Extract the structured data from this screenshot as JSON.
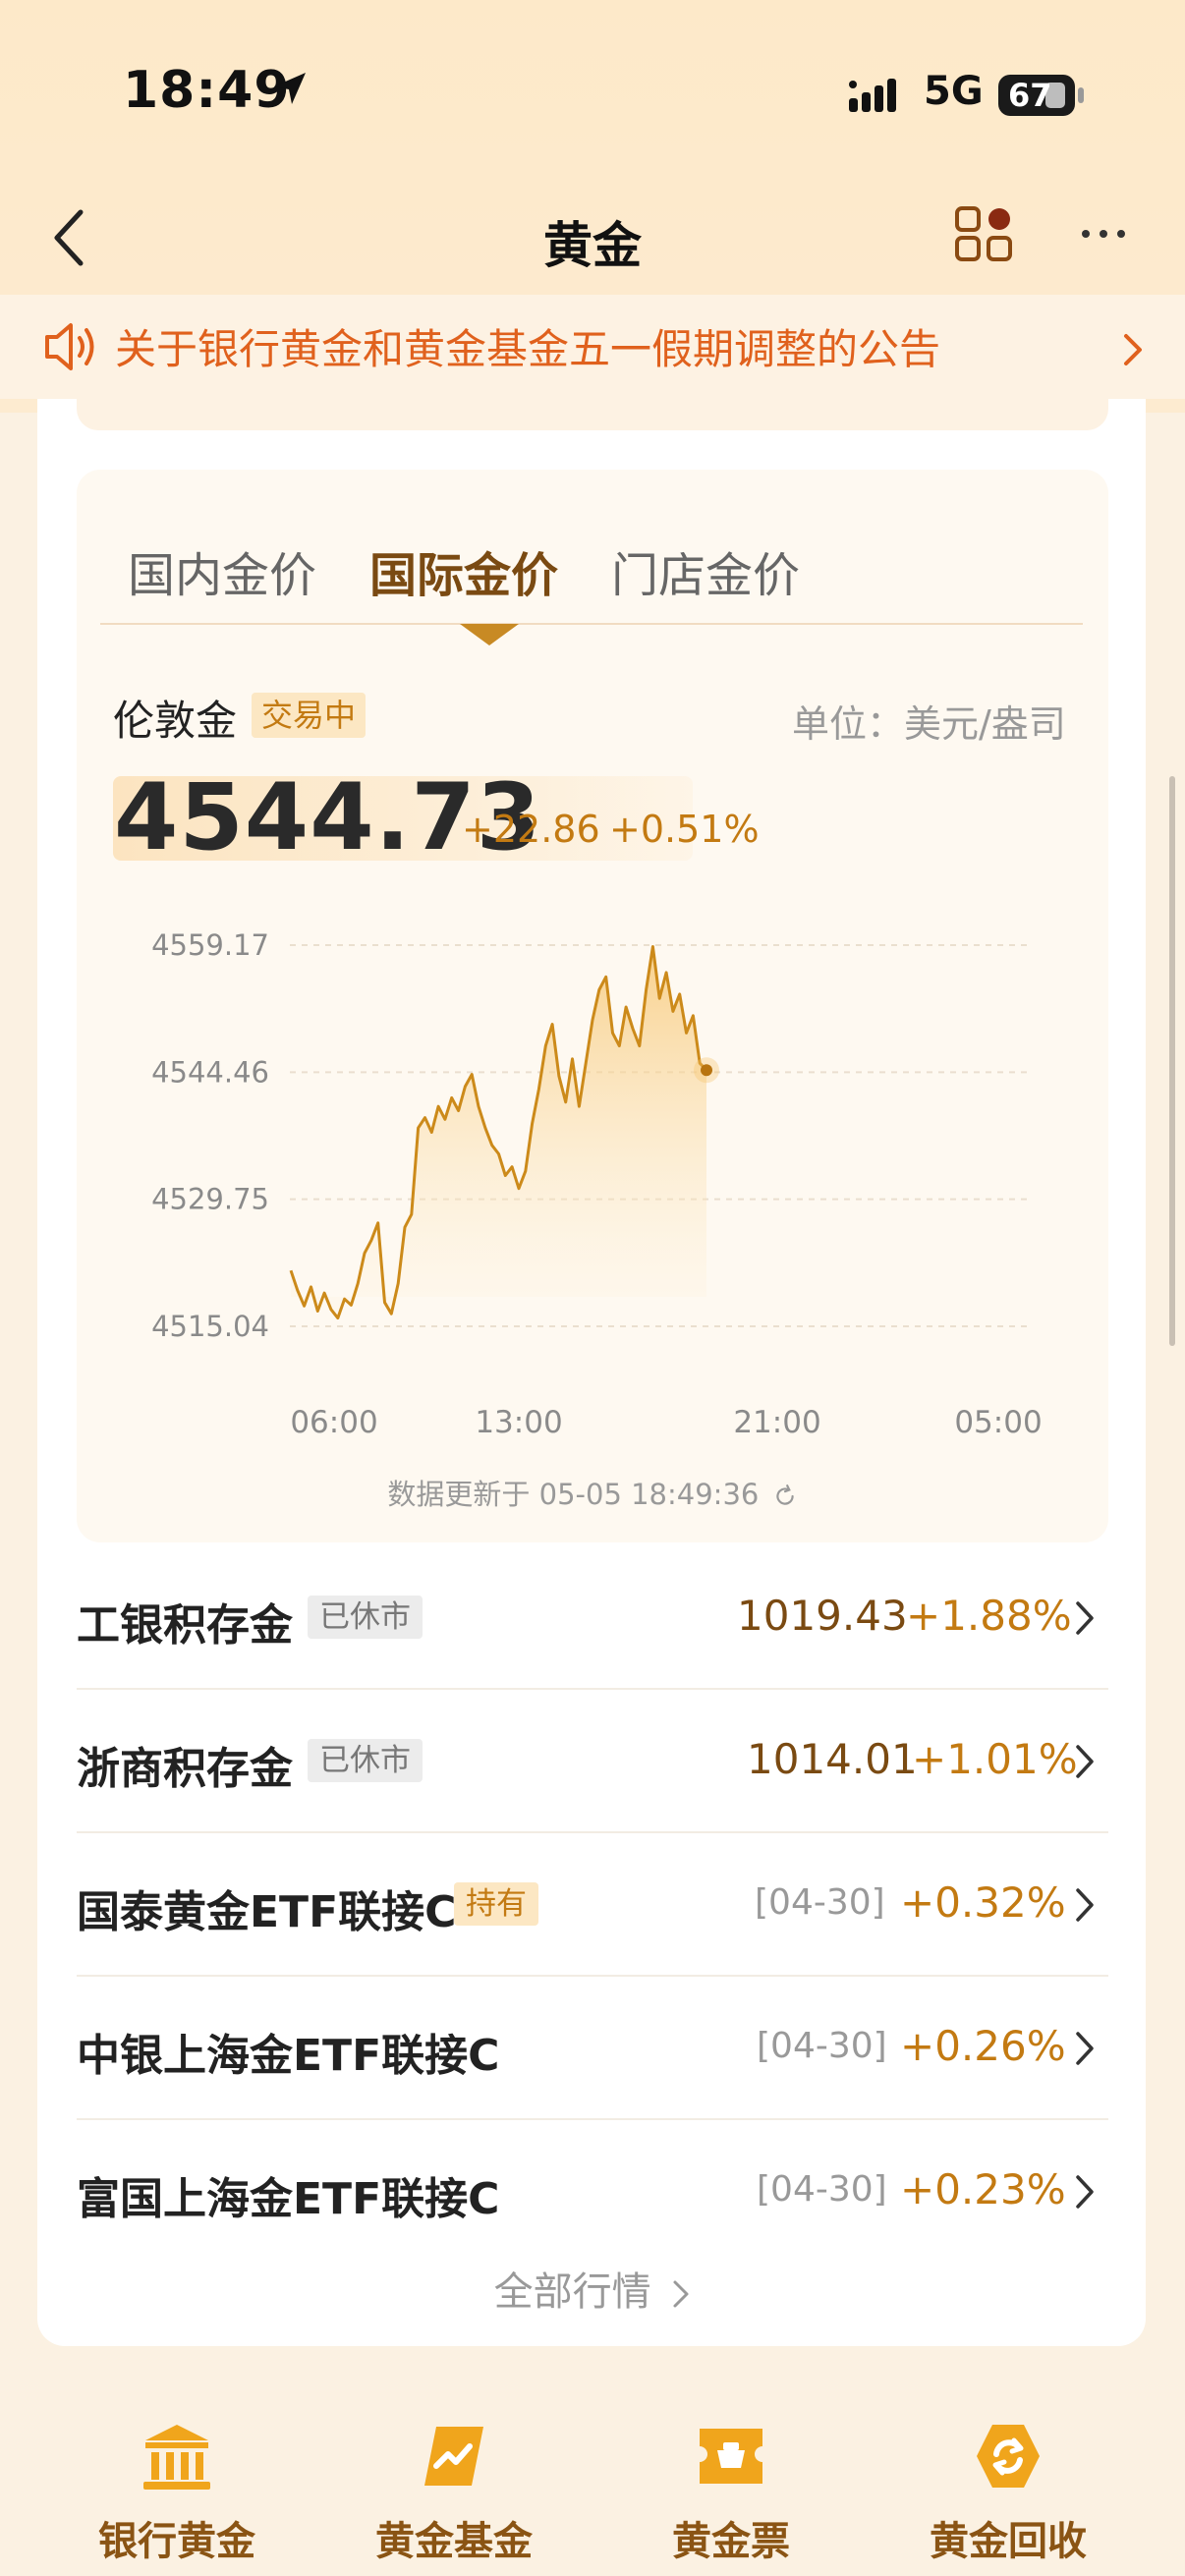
{
  "status_bar": {
    "time": "18:49",
    "network": "5G",
    "battery": "67"
  },
  "nav": {
    "title": "黄金"
  },
  "notice": {
    "text": "关于银行黄金和黄金基金五一假期调整的公告"
  },
  "tabs": [
    {
      "label": "国内金价",
      "active": false
    },
    {
      "label": "国际金价",
      "active": true
    },
    {
      "label": "门店金价",
      "active": false
    }
  ],
  "quote": {
    "market_name": "伦敦金",
    "status": "交易中",
    "unit": "单位：美元/盎司",
    "price": "4544.73",
    "change_abs": "+22.86",
    "change_pct": "+0.51%",
    "updated": "数据更新于 05-05 18:49:36"
  },
  "chart_data": {
    "type": "area",
    "y_ticks": [
      "4559.17",
      "4544.46",
      "4529.75",
      "4515.04"
    ],
    "ylim": [
      4515.04,
      4559.17
    ],
    "x_ticks": [
      "06:00",
      "13:00",
      "21:00",
      "05:00"
    ],
    "line_color": "#cc8a1a",
    "series": [
      {
        "values": [
          4521.5,
          4519.2,
          4517.4,
          4519.6,
          4516.8,
          4518.9,
          4517.0,
          4516.0,
          4518.2,
          4517.5,
          4520.0,
          4523.5,
          4525.0,
          4527.0,
          4517.8,
          4516.5,
          4520.0,
          4526.5,
          4528.0,
          4538.0,
          4539.2,
          4537.5,
          4540.5,
          4539.0,
          4541.5,
          4540.0,
          4542.8,
          4544.2,
          4540.5,
          4538.0,
          4536.0,
          4535.0,
          4532.5,
          4533.5,
          4531.0,
          4533.0,
          4538.5,
          4542.5,
          4547.5,
          4550.0,
          4544.0,
          4541.0,
          4546.0,
          4540.5,
          4545.5,
          4550.5,
          4554.0,
          4555.5,
          4549.0,
          4547.5,
          4552.0,
          4549.5,
          4547.5,
          4554.0,
          4559.0,
          4553.0,
          4556.0,
          4551.5,
          4553.5,
          4549.0,
          4551.0,
          4545.5,
          4544.7
        ]
      }
    ]
  },
  "products": [
    {
      "name": "工银积存金",
      "badge": "已休市",
      "badge_type": "closed",
      "price": "1019.43",
      "date": "",
      "change": "+1.88%"
    },
    {
      "name": "浙商积存金",
      "badge": "已休市",
      "badge_type": "closed",
      "price": "1014.01",
      "date": "",
      "change": "+1.01%"
    },
    {
      "name": "国泰黄金ETF联接C",
      "badge": "持有",
      "badge_type": "hold",
      "price": "",
      "date": "[04-30]",
      "change": "+0.32%"
    },
    {
      "name": "中银上海金ETF联接C",
      "badge": "",
      "badge_type": "",
      "price": "",
      "date": "[04-30]",
      "change": "+0.26%"
    },
    {
      "name": "富国上海金ETF联接C",
      "badge": "",
      "badge_type": "",
      "price": "",
      "date": "[04-30]",
      "change": "+0.23%"
    }
  ],
  "all_market_label": "全部行情",
  "bottom_tabs": [
    {
      "label": "银行黄金",
      "icon": "bank-icon"
    },
    {
      "label": "黄金基金",
      "icon": "fund-trend-icon"
    },
    {
      "label": "黄金票",
      "icon": "ticket-icon"
    },
    {
      "label": "黄金回收",
      "icon": "recycle-icon"
    }
  ]
}
